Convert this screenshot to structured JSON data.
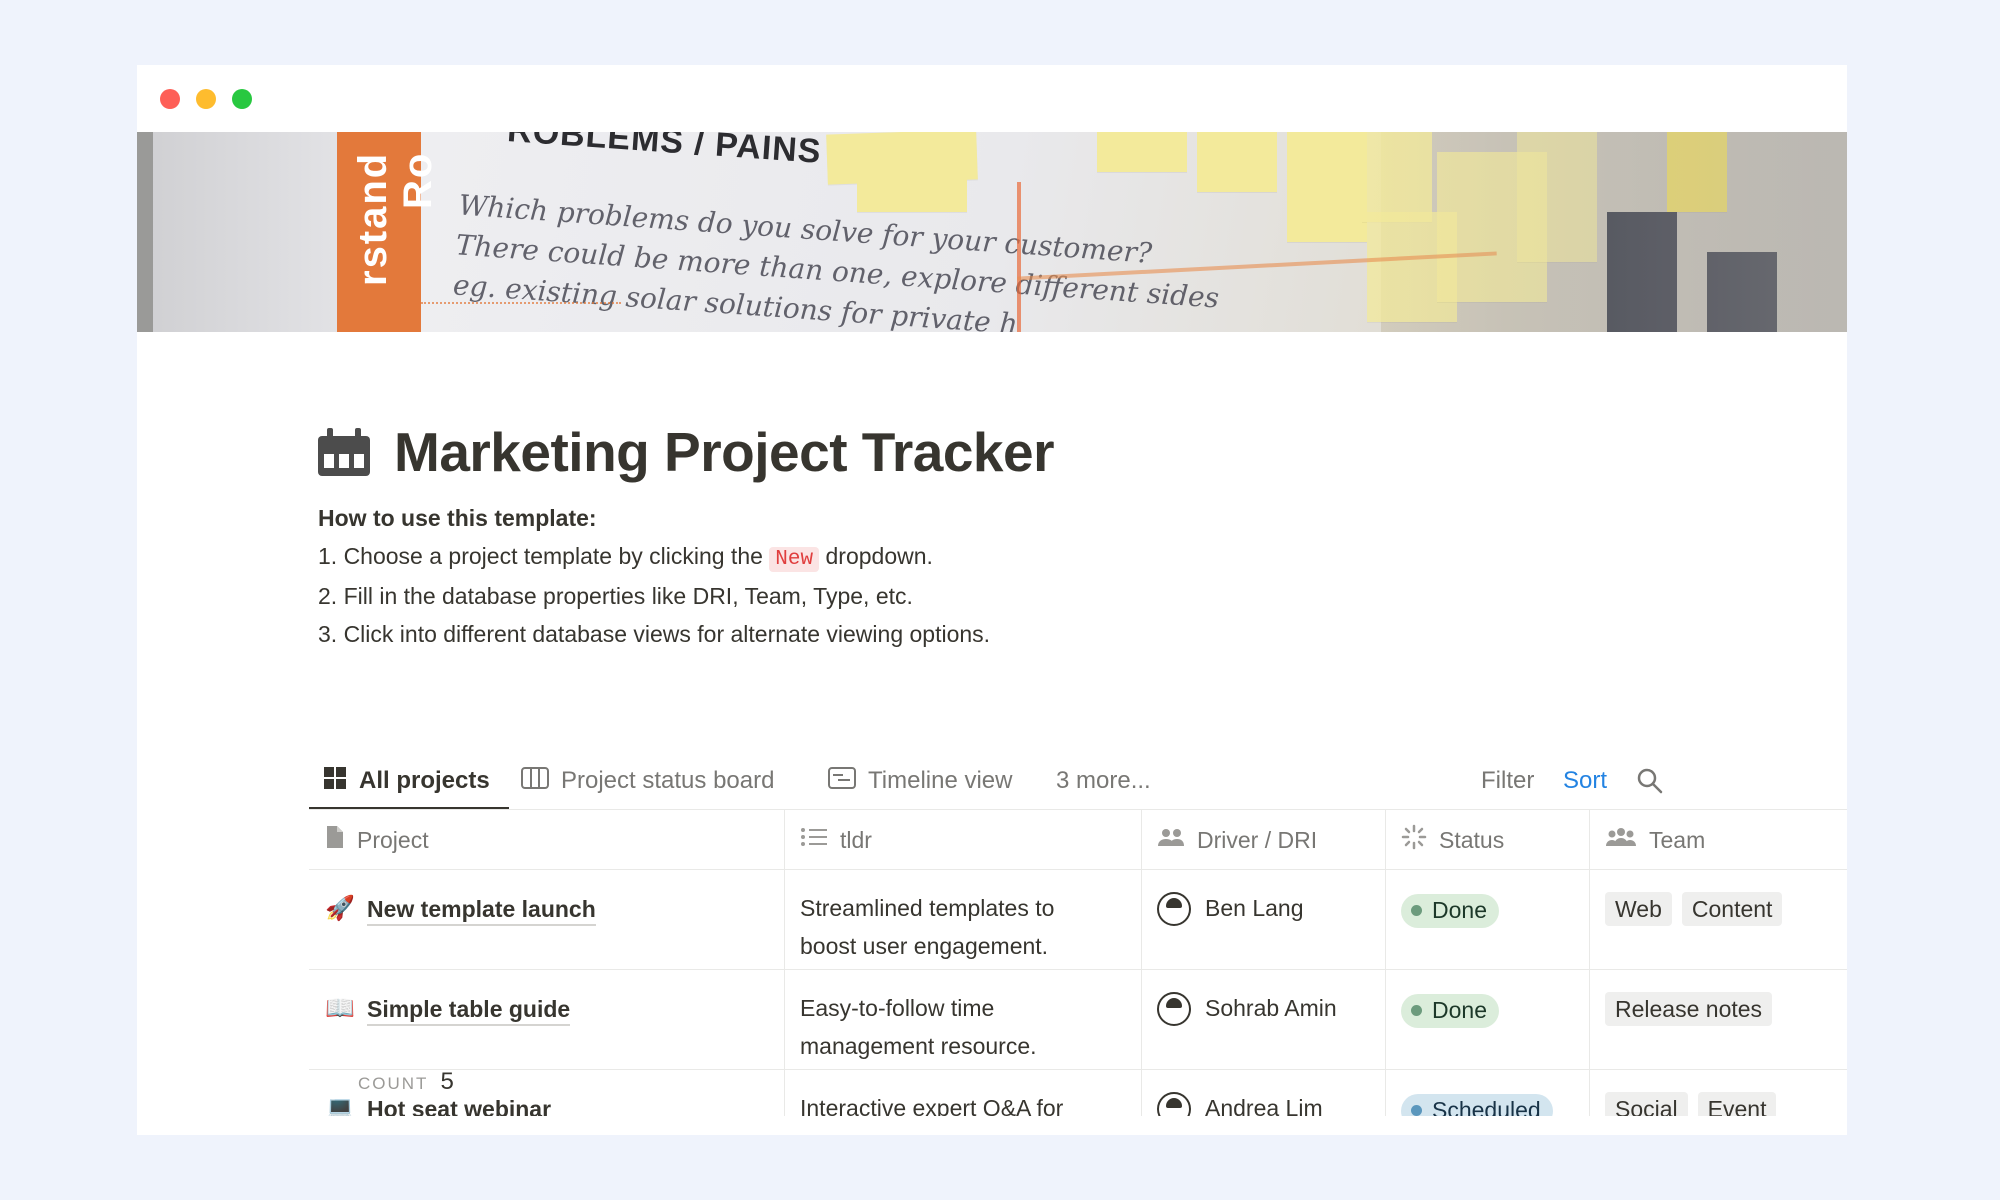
{
  "cover": {
    "vertical_text": "rstand Ro",
    "heading": "ROBLEMS / PAINS",
    "script_lines": [
      "Which problems do you solve for your customer?",
      "There could be more than one, explore different sides",
      "eg. existing solar solutions for private h"
    ]
  },
  "page": {
    "title": "Marketing Project Tracker",
    "icon": "calendar-icon"
  },
  "howto": {
    "heading": "How to use this template:",
    "line1_before": "1. Choose a project template by clicking the ",
    "line1_tag": "New",
    "line1_after": " dropdown.",
    "line2": "2. Fill in the database properties like DRI, Team, Type, etc.",
    "line3": "3. Click into different database views for alternate viewing options."
  },
  "views": {
    "tabs": [
      {
        "label": "All projects",
        "icon": "grid-icon",
        "active": true
      },
      {
        "label": "Project status board",
        "icon": "board-icon",
        "active": false
      },
      {
        "label": "Timeline view",
        "icon": "timeline-icon",
        "active": false
      }
    ],
    "more": "3 more...",
    "filter": "Filter",
    "sort": "Sort"
  },
  "table": {
    "columns": [
      {
        "label": "Project",
        "icon": "page-icon"
      },
      {
        "label": "tldr",
        "icon": "list-icon"
      },
      {
        "label": "Driver / DRI",
        "icon": "people-icon"
      },
      {
        "label": "Status",
        "icon": "loading-icon"
      },
      {
        "label": "Team",
        "icon": "group-icon"
      }
    ],
    "rows": [
      {
        "emoji": "🚀",
        "project": "New template launch",
        "tldr_1": "Streamlined templates to",
        "tldr_2": "boost user engagement.",
        "driver": "Ben Lang",
        "status": "Done",
        "teams": [
          "Web",
          "Content"
        ]
      },
      {
        "emoji": "📖",
        "project": "Simple table guide",
        "tldr_1": "Easy-to-follow time",
        "tldr_2": "management resource.",
        "driver": "Sohrab Amin",
        "status": "Done",
        "teams": [
          "Release notes"
        ]
      },
      {
        "emoji": "💻",
        "project": "Hot seat webinar",
        "tldr_1": "Interactive expert Q&A for",
        "tldr_2": "",
        "driver": "Andrea Lim",
        "status": "Scheduled",
        "teams": [
          "Social",
          "Event"
        ]
      }
    ]
  },
  "footer": {
    "count_label": "COUNT",
    "count_value": "5"
  },
  "colors": {
    "background": "#eff3fc",
    "text": "#37352f",
    "accent_blue": "#2383e2",
    "status_done": "#dbeddb",
    "status_scheduled": "#d3e5ef"
  }
}
